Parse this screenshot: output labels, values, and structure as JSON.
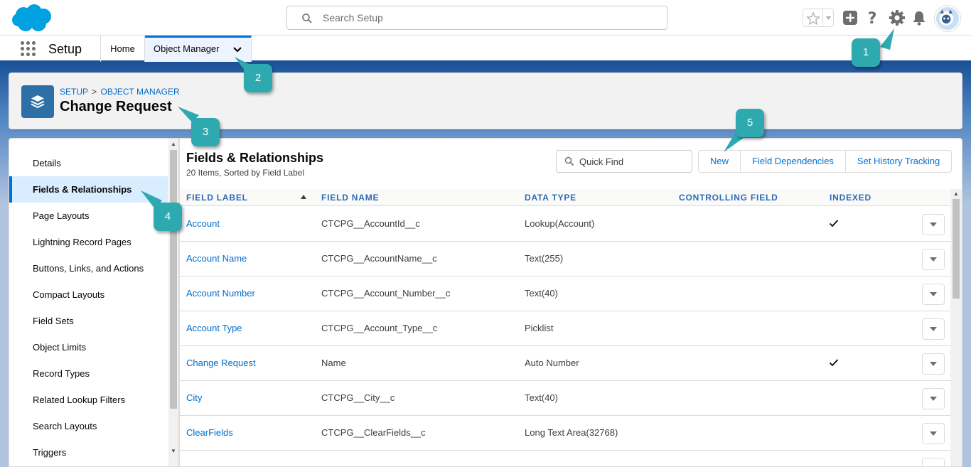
{
  "header": {
    "search_placeholder": "Search Setup"
  },
  "context_bar": {
    "app_name": "Setup",
    "tabs": [
      {
        "label": "Home"
      },
      {
        "label": "Object Manager"
      }
    ]
  },
  "page_header": {
    "breadcrumb": [
      "SETUP",
      ">",
      "OBJECT MANAGER"
    ],
    "title": "Change Request"
  },
  "left_nav": {
    "items": [
      {
        "label": "Details"
      },
      {
        "label": "Fields & Relationships"
      },
      {
        "label": "Page Layouts"
      },
      {
        "label": "Lightning Record Pages"
      },
      {
        "label": "Buttons, Links, and Actions"
      },
      {
        "label": "Compact Layouts"
      },
      {
        "label": "Field Sets"
      },
      {
        "label": "Object Limits"
      },
      {
        "label": "Record Types"
      },
      {
        "label": "Related Lookup Filters"
      },
      {
        "label": "Search Layouts"
      },
      {
        "label": "Triggers"
      }
    ],
    "active_index": 1
  },
  "content": {
    "title": "Fields & Relationships",
    "subtitle": "20 Items, Sorted by Field Label",
    "quick_find_placeholder": "Quick Find",
    "buttons": [
      "New",
      "Field Dependencies",
      "Set History Tracking"
    ],
    "columns": [
      "FIELD LABEL",
      "FIELD NAME",
      "DATA TYPE",
      "CONTROLLING FIELD",
      "INDEXED"
    ],
    "rows": [
      {
        "label": "Account",
        "name": "CTCPG__AccountId__c",
        "type": "Lookup(Account)",
        "controlling": "",
        "indexed": true
      },
      {
        "label": "Account Name",
        "name": "CTCPG__AccountName__c",
        "type": "Text(255)",
        "controlling": "",
        "indexed": false
      },
      {
        "label": "Account Number",
        "name": "CTCPG__Account_Number__c",
        "type": "Text(40)",
        "controlling": "",
        "indexed": false
      },
      {
        "label": "Account Type",
        "name": "CTCPG__Account_Type__c",
        "type": "Picklist",
        "controlling": "",
        "indexed": false
      },
      {
        "label": "Change Request",
        "name": "Name",
        "type": "Auto Number",
        "controlling": "",
        "indexed": true
      },
      {
        "label": "City",
        "name": "CTCPG__City__c",
        "type": "Text(40)",
        "controlling": "",
        "indexed": false
      },
      {
        "label": "ClearFields",
        "name": "CTCPG__ClearFields__c",
        "type": "Long Text Area(32768)",
        "controlling": "",
        "indexed": false
      }
    ]
  },
  "callouts": [
    "1",
    "2",
    "3",
    "4",
    "5"
  ],
  "colors": {
    "brand_blue": "#1b5297",
    "link": "#006dcc",
    "callout": "#2ea9b0",
    "active_nav": "#d8edff"
  },
  "icons": [
    "salesforce-cloud-logo",
    "search-icon",
    "star-icon",
    "add-icon",
    "help-icon",
    "gear-icon",
    "bell-icon",
    "app-launcher-icon",
    "chevron-down-icon",
    "layers-icon",
    "checkmark-icon"
  ]
}
